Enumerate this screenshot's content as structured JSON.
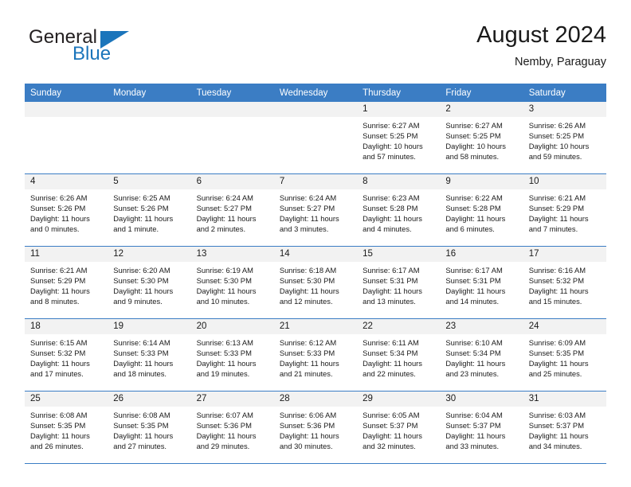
{
  "brand": {
    "name_part1": "General",
    "name_part2": "Blue",
    "triangle_color": "#1b75bb"
  },
  "header": {
    "title": "August 2024",
    "subtitle": "Nemby, Paraguay"
  },
  "theme": {
    "header_blue": "#3b7dc4",
    "band_gray": "#f2f2f2",
    "text": "#1a1a1a"
  },
  "weekday_headers": [
    "Sunday",
    "Monday",
    "Tuesday",
    "Wednesday",
    "Thursday",
    "Friday",
    "Saturday"
  ],
  "labels": {
    "sunrise_prefix": "Sunrise:",
    "sunset_prefix": "Sunset:",
    "daylight_prefix": "Daylight:"
  },
  "weeks": [
    [
      {
        "day": "",
        "blank": true,
        "sunrise": "",
        "sunset": "",
        "daylight": ""
      },
      {
        "day": "",
        "blank": true,
        "sunrise": "",
        "sunset": "",
        "daylight": ""
      },
      {
        "day": "",
        "blank": true,
        "sunrise": "",
        "sunset": "",
        "daylight": ""
      },
      {
        "day": "",
        "blank": true,
        "sunrise": "",
        "sunset": "",
        "daylight": ""
      },
      {
        "day": "1",
        "blank": false,
        "sunrise": "Sunrise: 6:27 AM",
        "sunset": "Sunset: 5:25 PM",
        "daylight": "Daylight: 10 hours and 57 minutes."
      },
      {
        "day": "2",
        "blank": false,
        "sunrise": "Sunrise: 6:27 AM",
        "sunset": "Sunset: 5:25 PM",
        "daylight": "Daylight: 10 hours and 58 minutes."
      },
      {
        "day": "3",
        "blank": false,
        "sunrise": "Sunrise: 6:26 AM",
        "sunset": "Sunset: 5:25 PM",
        "daylight": "Daylight: 10 hours and 59 minutes."
      }
    ],
    [
      {
        "day": "4",
        "blank": false,
        "sunrise": "Sunrise: 6:26 AM",
        "sunset": "Sunset: 5:26 PM",
        "daylight": "Daylight: 11 hours and 0 minutes."
      },
      {
        "day": "5",
        "blank": false,
        "sunrise": "Sunrise: 6:25 AM",
        "sunset": "Sunset: 5:26 PM",
        "daylight": "Daylight: 11 hours and 1 minute."
      },
      {
        "day": "6",
        "blank": false,
        "sunrise": "Sunrise: 6:24 AM",
        "sunset": "Sunset: 5:27 PM",
        "daylight": "Daylight: 11 hours and 2 minutes."
      },
      {
        "day": "7",
        "blank": false,
        "sunrise": "Sunrise: 6:24 AM",
        "sunset": "Sunset: 5:27 PM",
        "daylight": "Daylight: 11 hours and 3 minutes."
      },
      {
        "day": "8",
        "blank": false,
        "sunrise": "Sunrise: 6:23 AM",
        "sunset": "Sunset: 5:28 PM",
        "daylight": "Daylight: 11 hours and 4 minutes."
      },
      {
        "day": "9",
        "blank": false,
        "sunrise": "Sunrise: 6:22 AM",
        "sunset": "Sunset: 5:28 PM",
        "daylight": "Daylight: 11 hours and 6 minutes."
      },
      {
        "day": "10",
        "blank": false,
        "sunrise": "Sunrise: 6:21 AM",
        "sunset": "Sunset: 5:29 PM",
        "daylight": "Daylight: 11 hours and 7 minutes."
      }
    ],
    [
      {
        "day": "11",
        "blank": false,
        "sunrise": "Sunrise: 6:21 AM",
        "sunset": "Sunset: 5:29 PM",
        "daylight": "Daylight: 11 hours and 8 minutes."
      },
      {
        "day": "12",
        "blank": false,
        "sunrise": "Sunrise: 6:20 AM",
        "sunset": "Sunset: 5:30 PM",
        "daylight": "Daylight: 11 hours and 9 minutes."
      },
      {
        "day": "13",
        "blank": false,
        "sunrise": "Sunrise: 6:19 AM",
        "sunset": "Sunset: 5:30 PM",
        "daylight": "Daylight: 11 hours and 10 minutes."
      },
      {
        "day": "14",
        "blank": false,
        "sunrise": "Sunrise: 6:18 AM",
        "sunset": "Sunset: 5:30 PM",
        "daylight": "Daylight: 11 hours and 12 minutes."
      },
      {
        "day": "15",
        "blank": false,
        "sunrise": "Sunrise: 6:17 AM",
        "sunset": "Sunset: 5:31 PM",
        "daylight": "Daylight: 11 hours and 13 minutes."
      },
      {
        "day": "16",
        "blank": false,
        "sunrise": "Sunrise: 6:17 AM",
        "sunset": "Sunset: 5:31 PM",
        "daylight": "Daylight: 11 hours and 14 minutes."
      },
      {
        "day": "17",
        "blank": false,
        "sunrise": "Sunrise: 6:16 AM",
        "sunset": "Sunset: 5:32 PM",
        "daylight": "Daylight: 11 hours and 15 minutes."
      }
    ],
    [
      {
        "day": "18",
        "blank": false,
        "sunrise": "Sunrise: 6:15 AM",
        "sunset": "Sunset: 5:32 PM",
        "daylight": "Daylight: 11 hours and 17 minutes."
      },
      {
        "day": "19",
        "blank": false,
        "sunrise": "Sunrise: 6:14 AM",
        "sunset": "Sunset: 5:33 PM",
        "daylight": "Daylight: 11 hours and 18 minutes."
      },
      {
        "day": "20",
        "blank": false,
        "sunrise": "Sunrise: 6:13 AM",
        "sunset": "Sunset: 5:33 PM",
        "daylight": "Daylight: 11 hours and 19 minutes."
      },
      {
        "day": "21",
        "blank": false,
        "sunrise": "Sunrise: 6:12 AM",
        "sunset": "Sunset: 5:33 PM",
        "daylight": "Daylight: 11 hours and 21 minutes."
      },
      {
        "day": "22",
        "blank": false,
        "sunrise": "Sunrise: 6:11 AM",
        "sunset": "Sunset: 5:34 PM",
        "daylight": "Daylight: 11 hours and 22 minutes."
      },
      {
        "day": "23",
        "blank": false,
        "sunrise": "Sunrise: 6:10 AM",
        "sunset": "Sunset: 5:34 PM",
        "daylight": "Daylight: 11 hours and 23 minutes."
      },
      {
        "day": "24",
        "blank": false,
        "sunrise": "Sunrise: 6:09 AM",
        "sunset": "Sunset: 5:35 PM",
        "daylight": "Daylight: 11 hours and 25 minutes."
      }
    ],
    [
      {
        "day": "25",
        "blank": false,
        "sunrise": "Sunrise: 6:08 AM",
        "sunset": "Sunset: 5:35 PM",
        "daylight": "Daylight: 11 hours and 26 minutes."
      },
      {
        "day": "26",
        "blank": false,
        "sunrise": "Sunrise: 6:08 AM",
        "sunset": "Sunset: 5:35 PM",
        "daylight": "Daylight: 11 hours and 27 minutes."
      },
      {
        "day": "27",
        "blank": false,
        "sunrise": "Sunrise: 6:07 AM",
        "sunset": "Sunset: 5:36 PM",
        "daylight": "Daylight: 11 hours and 29 minutes."
      },
      {
        "day": "28",
        "blank": false,
        "sunrise": "Sunrise: 6:06 AM",
        "sunset": "Sunset: 5:36 PM",
        "daylight": "Daylight: 11 hours and 30 minutes."
      },
      {
        "day": "29",
        "blank": false,
        "sunrise": "Sunrise: 6:05 AM",
        "sunset": "Sunset: 5:37 PM",
        "daylight": "Daylight: 11 hours and 32 minutes."
      },
      {
        "day": "30",
        "blank": false,
        "sunrise": "Sunrise: 6:04 AM",
        "sunset": "Sunset: 5:37 PM",
        "daylight": "Daylight: 11 hours and 33 minutes."
      },
      {
        "day": "31",
        "blank": false,
        "sunrise": "Sunrise: 6:03 AM",
        "sunset": "Sunset: 5:37 PM",
        "daylight": "Daylight: 11 hours and 34 minutes."
      }
    ]
  ]
}
